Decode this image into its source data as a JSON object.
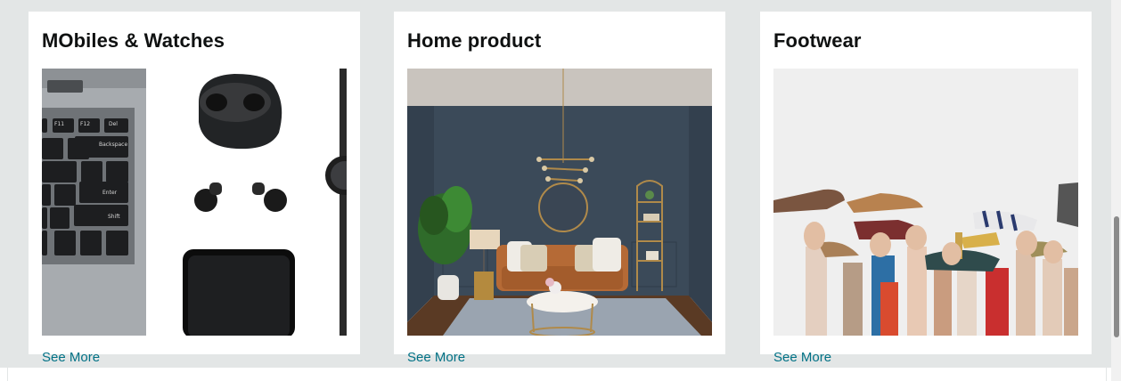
{
  "cards": [
    {
      "title": "MObiles & Watches",
      "link": "See More",
      "image": "laptop-earbuds-phone-watch"
    },
    {
      "title": "Home product",
      "link": "See More",
      "image": "living-room"
    },
    {
      "title": "Footwear",
      "link": "See More",
      "image": "hands-holding-shoes"
    }
  ],
  "laptop_keys": {
    "f11": "F11",
    "f12": "F12",
    "del": "Del",
    "backspace": "Backspace",
    "enter": "Enter",
    "shift": "Shift"
  },
  "colors": {
    "page_bg": "#e3e6e6",
    "card_bg": "#ffffff",
    "title": "#0f1111",
    "link": "#007185"
  }
}
